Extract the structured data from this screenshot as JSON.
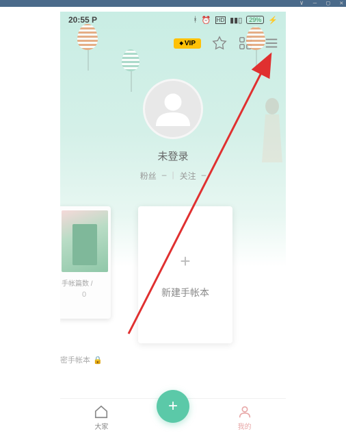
{
  "status_bar": {
    "time": "20:55",
    "indicator": "P",
    "battery": "29%",
    "icons": [
      "bluetooth",
      "alarm",
      "hd",
      "signal"
    ]
  },
  "top_actions": {
    "vip_label": "VIP"
  },
  "profile": {
    "login_status": "未登录",
    "fans_label": "粉丝",
    "fans_value": "–",
    "follow_label": "关注",
    "follow_value": "–"
  },
  "notebook": {
    "peek_meta": "手帐篇数 /",
    "peek_count": "0",
    "create_label": "新建手帐本",
    "secret_label": "密手帐本"
  },
  "bottom_nav": {
    "tab1": "大家",
    "tab2": "我的"
  }
}
